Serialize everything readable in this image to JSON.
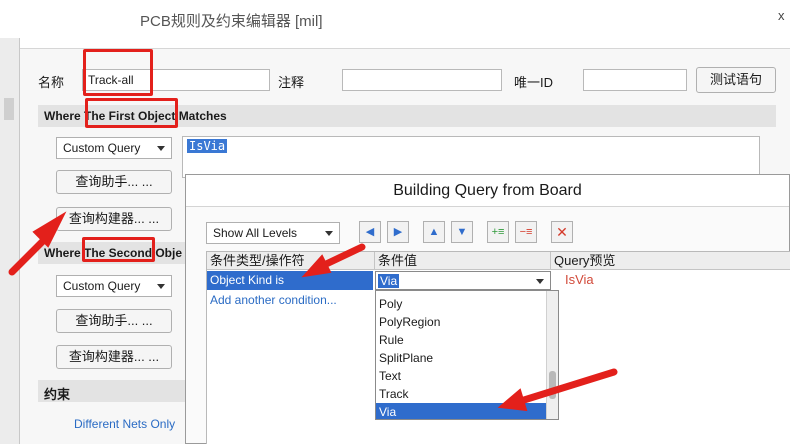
{
  "window": {
    "title": "PCB规则及约束编辑器 [mil]",
    "close": "x"
  },
  "rule": {
    "name_label": "名称",
    "name_value": "Track-all",
    "comment_label": "注释",
    "comment_value": "",
    "id_label": "唯一ID",
    "id_value": "",
    "test_button": "测试语句"
  },
  "first_object": {
    "header": "Where The First Object Matches",
    "query_type": "Custom Query",
    "query_text": "IsVia",
    "helper_button": "查询助手... ...",
    "builder_button": "查询构建器... ..."
  },
  "second_object": {
    "header": "Where The Second Obje",
    "query_type": "Custom Query",
    "helper_button": "查询助手... ...",
    "builder_button": "查询构建器... ..."
  },
  "constraints": {
    "header": "约束",
    "different_nets": "Different Nets Only"
  },
  "dialog": {
    "title": "Building Query from Board",
    "levels_select": "Show All Levels",
    "toolbar": [
      "arrow-left-icon",
      "arrow-right-icon",
      "arrow-up-icon",
      "arrow-down-icon",
      "add-condition-icon",
      "remove-condition-icon",
      "delete-icon"
    ],
    "columns": [
      "条件类型/操作符",
      "条件值",
      "Query预览"
    ],
    "condition_type": "Object Kind is",
    "add_condition": "Add another condition...",
    "condition_value": "Via",
    "preview": "IsVia",
    "options": [
      "Poly",
      "PolyRegion",
      "Rule",
      "SplitPlane",
      "Text",
      "Track",
      "Via"
    ],
    "selected_option": "Via"
  },
  "colors": {
    "annotation": "#e3201b",
    "selection": "#2f6ccc",
    "link": "#2a6bc4",
    "preview": "#d24a3a"
  }
}
